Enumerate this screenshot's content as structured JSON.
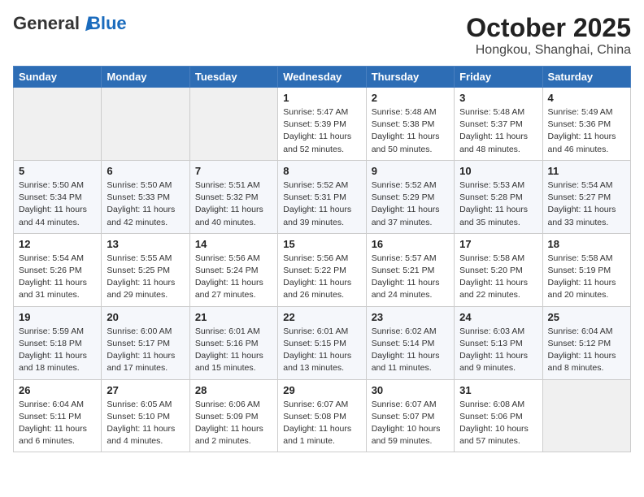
{
  "header": {
    "logo_general": "General",
    "logo_blue": "Blue",
    "month_title": "October 2025",
    "location": "Hongkou, Shanghai, China"
  },
  "days_of_week": [
    "Sunday",
    "Monday",
    "Tuesday",
    "Wednesday",
    "Thursday",
    "Friday",
    "Saturday"
  ],
  "weeks": [
    [
      {
        "day": "",
        "info": ""
      },
      {
        "day": "",
        "info": ""
      },
      {
        "day": "",
        "info": ""
      },
      {
        "day": "1",
        "info": "Sunrise: 5:47 AM\nSunset: 5:39 PM\nDaylight: 11 hours\nand 52 minutes."
      },
      {
        "day": "2",
        "info": "Sunrise: 5:48 AM\nSunset: 5:38 PM\nDaylight: 11 hours\nand 50 minutes."
      },
      {
        "day": "3",
        "info": "Sunrise: 5:48 AM\nSunset: 5:37 PM\nDaylight: 11 hours\nand 48 minutes."
      },
      {
        "day": "4",
        "info": "Sunrise: 5:49 AM\nSunset: 5:36 PM\nDaylight: 11 hours\nand 46 minutes."
      }
    ],
    [
      {
        "day": "5",
        "info": "Sunrise: 5:50 AM\nSunset: 5:34 PM\nDaylight: 11 hours\nand 44 minutes."
      },
      {
        "day": "6",
        "info": "Sunrise: 5:50 AM\nSunset: 5:33 PM\nDaylight: 11 hours\nand 42 minutes."
      },
      {
        "day": "7",
        "info": "Sunrise: 5:51 AM\nSunset: 5:32 PM\nDaylight: 11 hours\nand 40 minutes."
      },
      {
        "day": "8",
        "info": "Sunrise: 5:52 AM\nSunset: 5:31 PM\nDaylight: 11 hours\nand 39 minutes."
      },
      {
        "day": "9",
        "info": "Sunrise: 5:52 AM\nSunset: 5:29 PM\nDaylight: 11 hours\nand 37 minutes."
      },
      {
        "day": "10",
        "info": "Sunrise: 5:53 AM\nSunset: 5:28 PM\nDaylight: 11 hours\nand 35 minutes."
      },
      {
        "day": "11",
        "info": "Sunrise: 5:54 AM\nSunset: 5:27 PM\nDaylight: 11 hours\nand 33 minutes."
      }
    ],
    [
      {
        "day": "12",
        "info": "Sunrise: 5:54 AM\nSunset: 5:26 PM\nDaylight: 11 hours\nand 31 minutes."
      },
      {
        "day": "13",
        "info": "Sunrise: 5:55 AM\nSunset: 5:25 PM\nDaylight: 11 hours\nand 29 minutes."
      },
      {
        "day": "14",
        "info": "Sunrise: 5:56 AM\nSunset: 5:24 PM\nDaylight: 11 hours\nand 27 minutes."
      },
      {
        "day": "15",
        "info": "Sunrise: 5:56 AM\nSunset: 5:22 PM\nDaylight: 11 hours\nand 26 minutes."
      },
      {
        "day": "16",
        "info": "Sunrise: 5:57 AM\nSunset: 5:21 PM\nDaylight: 11 hours\nand 24 minutes."
      },
      {
        "day": "17",
        "info": "Sunrise: 5:58 AM\nSunset: 5:20 PM\nDaylight: 11 hours\nand 22 minutes."
      },
      {
        "day": "18",
        "info": "Sunrise: 5:58 AM\nSunset: 5:19 PM\nDaylight: 11 hours\nand 20 minutes."
      }
    ],
    [
      {
        "day": "19",
        "info": "Sunrise: 5:59 AM\nSunset: 5:18 PM\nDaylight: 11 hours\nand 18 minutes."
      },
      {
        "day": "20",
        "info": "Sunrise: 6:00 AM\nSunset: 5:17 PM\nDaylight: 11 hours\nand 17 minutes."
      },
      {
        "day": "21",
        "info": "Sunrise: 6:01 AM\nSunset: 5:16 PM\nDaylight: 11 hours\nand 15 minutes."
      },
      {
        "day": "22",
        "info": "Sunrise: 6:01 AM\nSunset: 5:15 PM\nDaylight: 11 hours\nand 13 minutes."
      },
      {
        "day": "23",
        "info": "Sunrise: 6:02 AM\nSunset: 5:14 PM\nDaylight: 11 hours\nand 11 minutes."
      },
      {
        "day": "24",
        "info": "Sunrise: 6:03 AM\nSunset: 5:13 PM\nDaylight: 11 hours\nand 9 minutes."
      },
      {
        "day": "25",
        "info": "Sunrise: 6:04 AM\nSunset: 5:12 PM\nDaylight: 11 hours\nand 8 minutes."
      }
    ],
    [
      {
        "day": "26",
        "info": "Sunrise: 6:04 AM\nSunset: 5:11 PM\nDaylight: 11 hours\nand 6 minutes."
      },
      {
        "day": "27",
        "info": "Sunrise: 6:05 AM\nSunset: 5:10 PM\nDaylight: 11 hours\nand 4 minutes."
      },
      {
        "day": "28",
        "info": "Sunrise: 6:06 AM\nSunset: 5:09 PM\nDaylight: 11 hours\nand 2 minutes."
      },
      {
        "day": "29",
        "info": "Sunrise: 6:07 AM\nSunset: 5:08 PM\nDaylight: 11 hours\nand 1 minute."
      },
      {
        "day": "30",
        "info": "Sunrise: 6:07 AM\nSunset: 5:07 PM\nDaylight: 10 hours\nand 59 minutes."
      },
      {
        "day": "31",
        "info": "Sunrise: 6:08 AM\nSunset: 5:06 PM\nDaylight: 10 hours\nand 57 minutes."
      },
      {
        "day": "",
        "info": ""
      }
    ]
  ]
}
